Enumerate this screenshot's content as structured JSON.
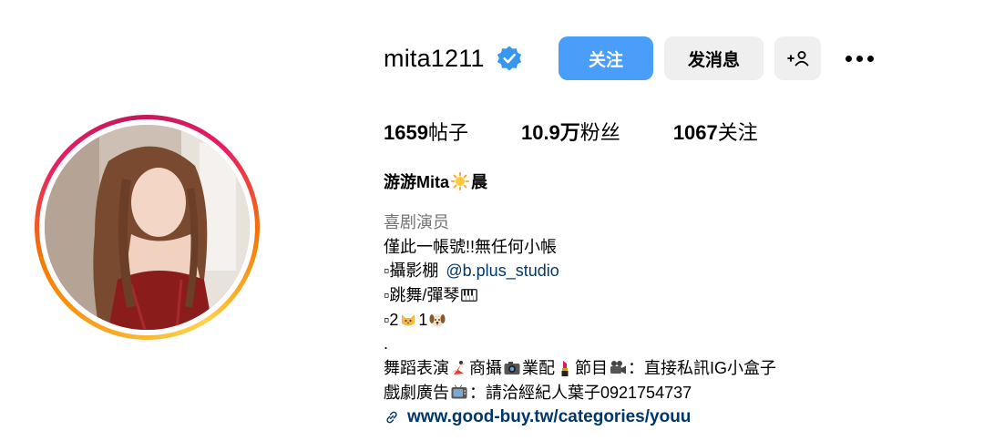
{
  "profile": {
    "username": "mita1211",
    "verified": true,
    "follow_label": "关注",
    "message_label": "发消息",
    "suggest_label": "+",
    "more_label": "more-options"
  },
  "stats": {
    "posts_count": "1659",
    "posts_label": "帖子",
    "followers_count": "10.9万",
    "followers_label": "粉丝",
    "following_count": "1067",
    "following_label": "关注"
  },
  "bio": {
    "name_part1": "游游Mita",
    "name_part2": "晨",
    "category": "喜剧演员",
    "line1": "僅此一帳號!!無任何小帳",
    "line2_prefix": "▫攝影棚",
    "line2_mention": "@b.plus_studio",
    "line3": "▫跳舞/彈琴",
    "line4_a": "▫2",
    "line4_b": "1",
    "line5": ".",
    "line6_a": "舞蹈表演",
    "line6_b": "商攝",
    "line6_c": "業配",
    "line6_d": "節目",
    "line6_e": "：直接私訊IG小盒子",
    "line7_a": "戲劇廣告",
    "line7_b": "：請洽經紀人葉子0921754737",
    "link": "www.good-buy.tw/categories/youu"
  },
  "icons": {
    "verified": "verified-badge-icon",
    "sun": "sun-emoji-icon",
    "piano": "piano-emoji-icon",
    "cat": "cat-emoji-icon",
    "dog": "dog-emoji-icon",
    "dancer": "dancer-emoji-icon",
    "camera": "camera-emoji-icon",
    "lipstick": "lipstick-emoji-icon",
    "film_camera": "film-camera-emoji-icon",
    "tv": "tv-emoji-icon",
    "link": "link-icon"
  },
  "colors": {
    "accent": "#4a9df8",
    "secondary_button": "#efefef",
    "link": "#00376b",
    "muted": "#737373"
  }
}
